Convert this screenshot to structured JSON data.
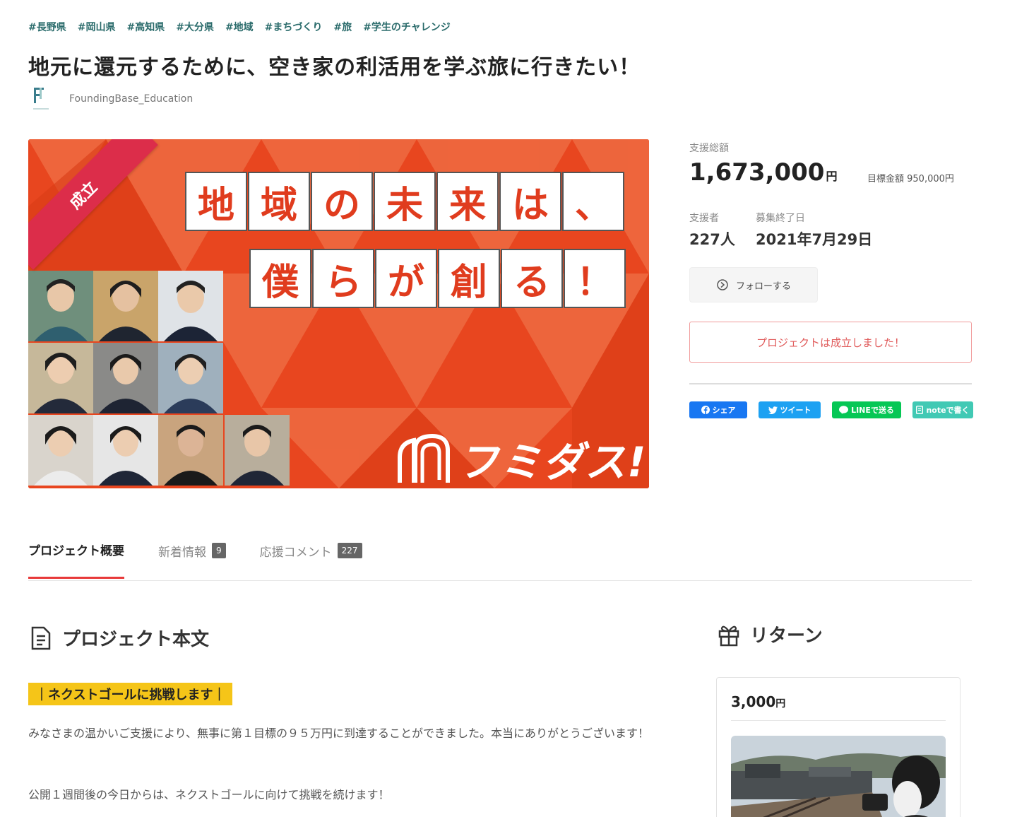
{
  "tags": [
    "#長野県",
    "#岡山県",
    "#高知県",
    "#大分県",
    "#地域",
    "#まちづくり",
    "#旅",
    "#学生のチャレンジ"
  ],
  "title": "地元に還元するために、空き家の利活用を学ぶ旅に行きたい！",
  "owner": {
    "name": "FoundingBase_Education"
  },
  "hero": {
    "ribbon": "成立",
    "line1": [
      "地",
      "域",
      "の",
      "未",
      "来",
      "は",
      "、"
    ],
    "line2": [
      "僕",
      "ら",
      "が",
      "創",
      "る",
      "！"
    ],
    "brand": "フミダス!"
  },
  "stats": {
    "amount_label": "支援総額",
    "amount": "1,673,000",
    "amount_unit": "円",
    "goal": "目標金額 950,000円",
    "supporters_label": "支援者",
    "supporters": "227人",
    "end_label": "募集終了日",
    "end_date": "2021年7月29日"
  },
  "follow_label": "フォローする",
  "success_text": "プロジェクトは成立しました！",
  "share": {
    "facebook": "シェア",
    "twitter": "ツイート",
    "line": "LINEで送る",
    "note": "noteで書く"
  },
  "colors": {
    "facebook": "#1877f2",
    "twitter": "#1da1f2",
    "line": "#06c755",
    "note": "#41c9b4",
    "accent": "#e83a3a",
    "hero": "#e8461f"
  },
  "tabs": [
    {
      "label": "プロジェクト概要",
      "count": ""
    },
    {
      "label": "新着情報",
      "count": "9"
    },
    {
      "label": "応援コメント",
      "count": "227"
    }
  ],
  "body": {
    "heading": "プロジェクト本文",
    "highlight": "｜ネクストゴールに挑戦します｜",
    "para1": "みなさまの温かいご支援により、無事に第１目標の９５万円に到達することができました。本当にありがとうございます！",
    "para2": "公開１週間後の今日からは、ネクストゴールに向けて挑戦を続けます！"
  },
  "returns": {
    "heading": "リターン",
    "price": "3,000",
    "unit": "円"
  }
}
